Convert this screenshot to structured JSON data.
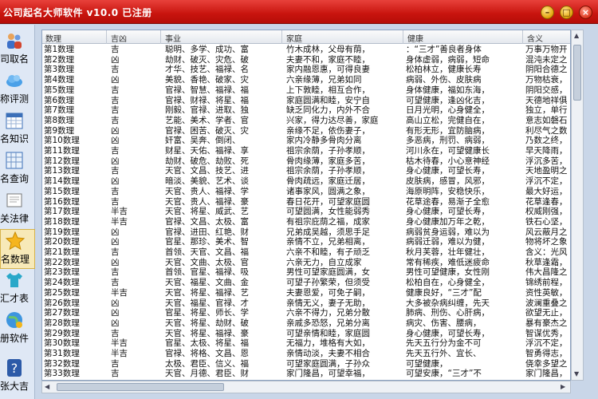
{
  "window": {
    "title": "公司起名大师软件 v10.0  已注册"
  },
  "sidebar": {
    "items": [
      {
        "label": "司取名"
      },
      {
        "label": "称评测"
      },
      {
        "label": "名知识"
      },
      {
        "label": "名查询"
      },
      {
        "label": "关法律"
      },
      {
        "label": "名数理"
      },
      {
        "label": "汇才表"
      },
      {
        "label": "册软件"
      },
      {
        "label": "张大吉"
      }
    ]
  },
  "table": {
    "columns": [
      "数理",
      "吉凶",
      "事业",
      "家庭",
      "健康",
      "含义"
    ],
    "rows": [
      [
        "第1数理",
        "吉",
        "聪明、多学、成功、富",
        "竹木成林，父母有荫，",
        "：“三才”善良者身体",
        "万事万物开"
      ],
      [
        "第2数理",
        "凶",
        "劫财、破灭、灾危、破",
        "夫妻不和，家庭不睦，",
        "身体虚弱，病弱，短命",
        "混沌未定之"
      ],
      [
        "第3数理",
        "吉",
        "才华、技艺、福禄、名",
        "家内融恩惠，可得良妻",
        "松柏林立，健康长寿",
        "阴阳合德之"
      ],
      [
        "第4数理",
        "凶",
        "美貌、香艳、破家、灾",
        "六亲缘薄，兄弟如同",
        "病弱、外伤、皮肤病",
        "万物枯衰，"
      ],
      [
        "第5数理",
        "吉",
        "官禄、智慧、福禄、福",
        "上下敦睦，相互合作，",
        "身体健康，福如东海，",
        "阴阳交感，"
      ],
      [
        "第6数理",
        "吉",
        "官禄、财禄、将星、福",
        "家庭圆满和睦，安宁自",
        "可望健康，逢凶化吉，",
        "天德地祥俱"
      ],
      [
        "第7数理",
        "吉",
        "刚毅、官禄、进取、独",
        "缺乏同化力，内外不合",
        "日月光明，心身健全，",
        "独立，单行"
      ],
      [
        "第8数理",
        "吉",
        "艺能、美术、学者、官",
        "兴家，得力达尽善，家庭",
        "高山立松，完健自在，",
        "意志如磐石"
      ],
      [
        "第9数理",
        "凶",
        "官禄、困苦、破灭、灾",
        "亲缘不足，依伤妻子，",
        "有形无形，宜防脑病，",
        "利尽气之数"
      ],
      [
        "第10数理",
        "凶",
        "奸富、吴奔、倒闭、",
        "家内冷静多骨肉分离",
        "多恶病，刑罚、病弱，",
        "乃数之终，"
      ],
      [
        "第11数理",
        "吉",
        "财星、天佑、福禄、享",
        "祖宗余荫，子孙孝顺，",
        "河川永在，可望健康长",
        "早天降雨，"
      ],
      [
        "第12数理",
        "凶",
        "劫财、破危、劫败、死",
        "骨肉缘薄，家庭多苦，",
        "枯木待春，小心意神经",
        "浮沉多苦，"
      ],
      [
        "第13数理",
        "吉",
        "天官、文昌、技艺、进",
        "祖宗余荫，子孙孝顺，",
        "身心健康，可望长寿，",
        "天地盈明之"
      ],
      [
        "第14数理",
        "凶",
        "暗淡、美貌、艺术、谈",
        "骨肉疏远，家庭迁居，",
        "皮肤病，感冒，风邪，",
        "浮沉不定，"
      ],
      [
        "第15数理",
        "吉",
        "天官、贵人、福禄、学",
        "诸事家风，圆满之象，",
        "海原明阵，安稳快乐，",
        "最大好运，"
      ],
      [
        "第16数理",
        "吉",
        "天官、贵人、福禄、豪",
        "春日花开，可望家庭圆",
        "花草途春，易渐子全愈",
        "花草逢春，"
      ],
      [
        "第17数理",
        "半吉",
        "天官、将星、威武、艺",
        "可望圆满，女性能弱秀",
        "身心健康，可望长寿，",
        "权威刚强，"
      ],
      [
        "第18数理",
        "半吉",
        "官禄、文昌、太极、富",
        "有祖宗庇荫之福，成家",
        "身心健康加万年之乾，",
        "铁石心坚，"
      ],
      [
        "第19数理",
        "凶",
        "官禄、进田、红艳、财",
        "兄弟成吴越，须思手足",
        "病弱贫身运弱，难以为",
        "风云蔽月之"
      ],
      [
        "第20数理",
        "凶",
        "官星、那珍、美术、智",
        "亲情不立，兄弟相离，",
        "病弱迁弱，难以为健，",
        "物将坏之象"
      ],
      [
        "第21数理",
        "吉",
        "首领、天官、文昌、福",
        "六亲不和睦，有子顽乏",
        "秋月芙蓉，壮年健壮，",
        "含义：光风"
      ],
      [
        "第22数理",
        "凶",
        "天官、文曲、太极、官",
        "六亲无力，自立成家",
        "常有稀疾，难低迷疲命",
        "秋草逢霜，"
      ],
      [
        "第23数理",
        "吉",
        "首领、官星、福禄、吸",
        "男性可望家庭圆满，女",
        "男性可望健康，女性刚",
        "伟大昌隆之"
      ],
      [
        "第24数理",
        "吉",
        "天官、福星、文曲、金",
        "可望子孙繁荣，但须受",
        "松柏自在，心身健全，",
        "锦绣前程，"
      ],
      [
        "第25数理",
        "半吉",
        "天官、将星、福禄、艺",
        "夫妻恩爱，可免子嗣，",
        "健康良好，“三才”配",
        "资性英敏，"
      ],
      [
        "第26数理",
        "凶",
        "天官、福星、官禄、才",
        "亲情无义，妻子无助，",
        "大多被杂病纠缠，先天",
        "波澜重叠之"
      ],
      [
        "第27数理",
        "凶",
        "官星、将星、师长、学",
        "六亲不得力，兄弟分散",
        "肺病、刑伤、心肝病，",
        "欲望无止，"
      ],
      [
        "第28数理",
        "凶",
        "天官、将星、劫财、破",
        "亲戚多恐怒，兄弟分离",
        "病灾、伤害、腰病，",
        "暴有豪杰之"
      ],
      [
        "第29数理",
        "吉",
        "天官、将星、福禄、豪",
        "可望亲情和睦，家庭圆",
        "身心健康，可望长寿，",
        "智谋优秀，"
      ],
      [
        "第30数理",
        "半吉",
        "官星、太极、将星、福",
        "无福力，堆格有大如，",
        "先天五行分为金不可",
        "浮沉不定，"
      ],
      [
        "第31数理",
        "半吉",
        "官禄、将格、文昌、恩",
        "亲情动淡，夫妻不相合",
        "先天五行外、宜长、",
        "智勇得志，"
      ],
      [
        "第32数理",
        "吉",
        "太极、君臣、信义、福",
        "可望家庭圆满，子孙众",
        "可望健康，",
        "侥幸多望之"
      ],
      [
        "第33数理",
        "吉",
        "天官、月德、君臣、财",
        "家门隆昌，可望幸福，",
        "可望安康，“三才”不",
        "家门隆昌，"
      ]
    ]
  }
}
